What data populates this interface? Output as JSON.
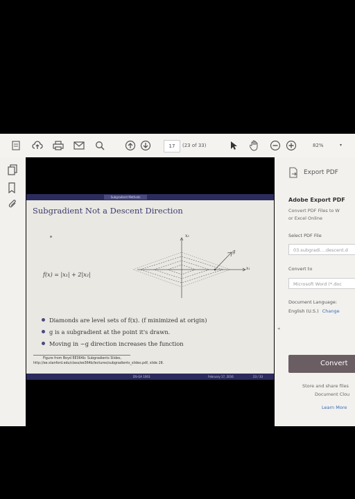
{
  "toolbar": {
    "page_number": "17",
    "page_of": "(23 of 33)",
    "zoom": "82%"
  },
  "slide": {
    "ribbon_text": "Subgradient Methods",
    "title": "Subgradient Not a Descent Direction",
    "formula": "f(x) = |x₁| + 2|x₂|",
    "axis_x1": "x₂",
    "axis_x2": "x₁",
    "label_g": "g",
    "bullets": [
      "Diamonds are level sets of f(x). (f minimized at origin)",
      "g is a subgradient at the point it's drawn.",
      "Moving in −g direction increases the function"
    ],
    "ref_line1": "Figure from Boyd EE364b: Subgradients Slides,",
    "ref_line2": "http://ee.stanford.edu/class/ee364b/lectures/subgradients_slides.pdf, slide 28.",
    "footer_left": "DS-GA 1003",
    "footer_mid": "February 17, 2016",
    "footer_right": "23 / 33"
  },
  "right_panel": {
    "export_title": "Export PDF",
    "heading": "Adobe Export PDF",
    "desc_line1": "Convert PDF Files to W",
    "desc_line2": "or Excel Online",
    "select_label": "Select PDF File",
    "file_value": "03.subgradi....descent.d",
    "convert_to_label": "Convert to",
    "convert_to_value": "Microsoft Word (*.doc",
    "doc_lang_label": "Document Language:",
    "doc_lang_value": "English (U.S.)",
    "change_link": "Change",
    "convert_button": "Convert",
    "store_line1": "Store and share files",
    "store_line2": "Document Clou",
    "learn_more": "Learn More"
  }
}
